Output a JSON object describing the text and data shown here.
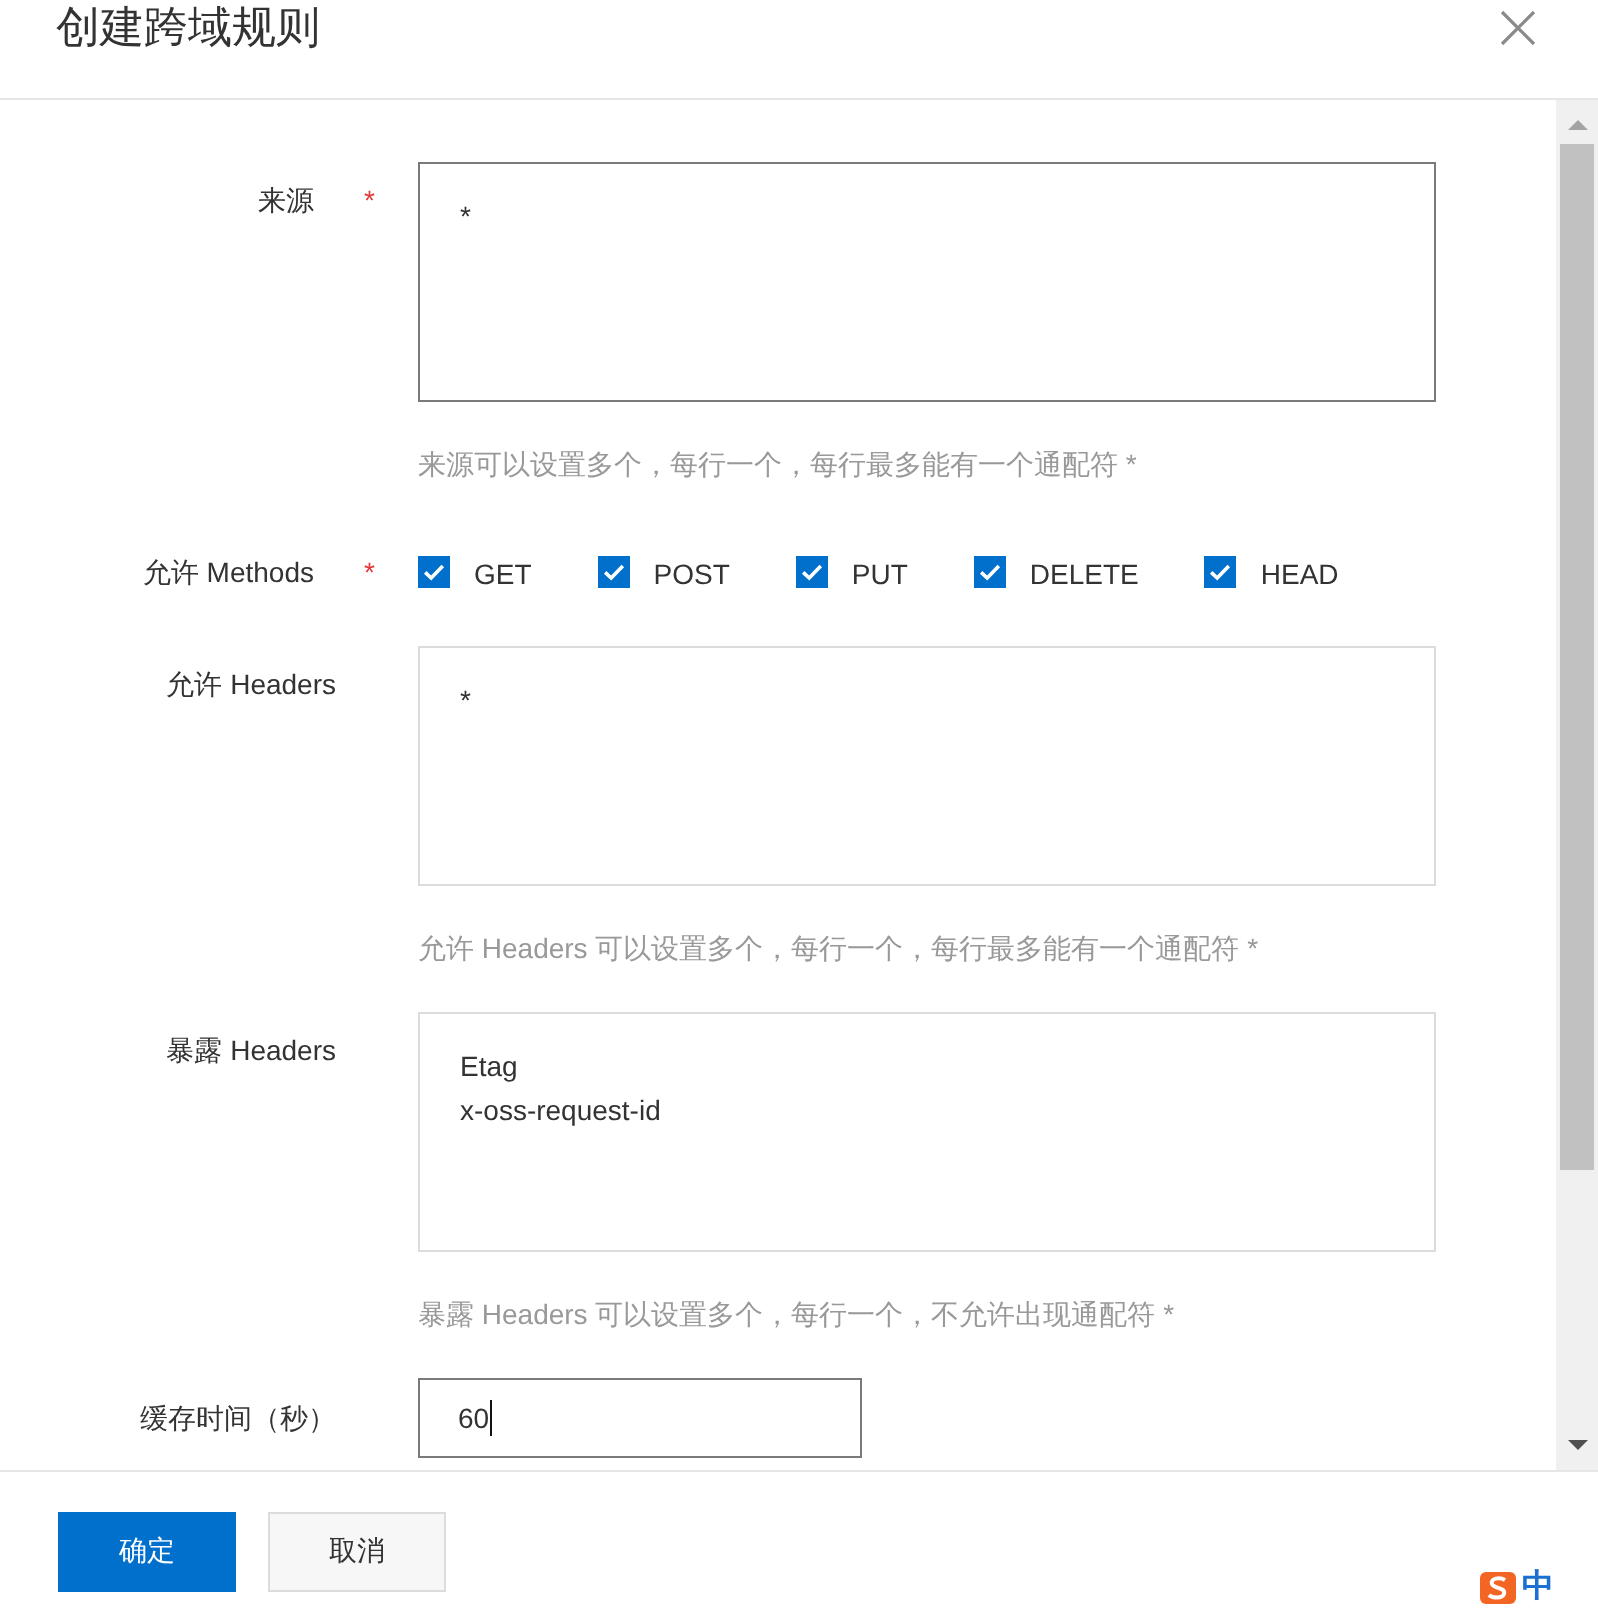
{
  "dialog": {
    "title": "创建跨域规则"
  },
  "form": {
    "fields": [
      {
        "kind": "textarea",
        "label": "来源",
        "required_mark": "*",
        "value": "*",
        "hovered": true,
        "hint": "来源可以设置多个，每行一个，每行最多能有一个通配符 *"
      },
      {
        "kind": "checkboxes",
        "label": "允许 Methods",
        "required_mark": "*",
        "options": [
          {
            "label": "GET",
            "checked": true
          },
          {
            "label": "POST",
            "checked": true
          },
          {
            "label": "PUT",
            "checked": true
          },
          {
            "label": "DELETE",
            "checked": true
          },
          {
            "label": "HEAD",
            "checked": true
          }
        ]
      },
      {
        "kind": "textarea",
        "label": "允许 Headers",
        "value": "*",
        "hovered": false,
        "hint": "允许 Headers 可以设置多个，每行一个，每行最多能有一个通配符 *"
      },
      {
        "kind": "textarea",
        "label": "暴露 Headers",
        "value": "Etag\nx-oss-request-id",
        "hovered": false,
        "hint": "暴露 Headers 可以设置多个，每行一个，不允许出现通配符 *"
      },
      {
        "kind": "input",
        "label": "缓存时间（秒）",
        "value": "60",
        "focused": true
      }
    ]
  },
  "footer": {
    "buttons": [
      {
        "label": "确定",
        "kind": "primary"
      },
      {
        "label": "取消",
        "kind": "secondary"
      }
    ]
  },
  "ime_indicator": {
    "text": "中"
  }
}
